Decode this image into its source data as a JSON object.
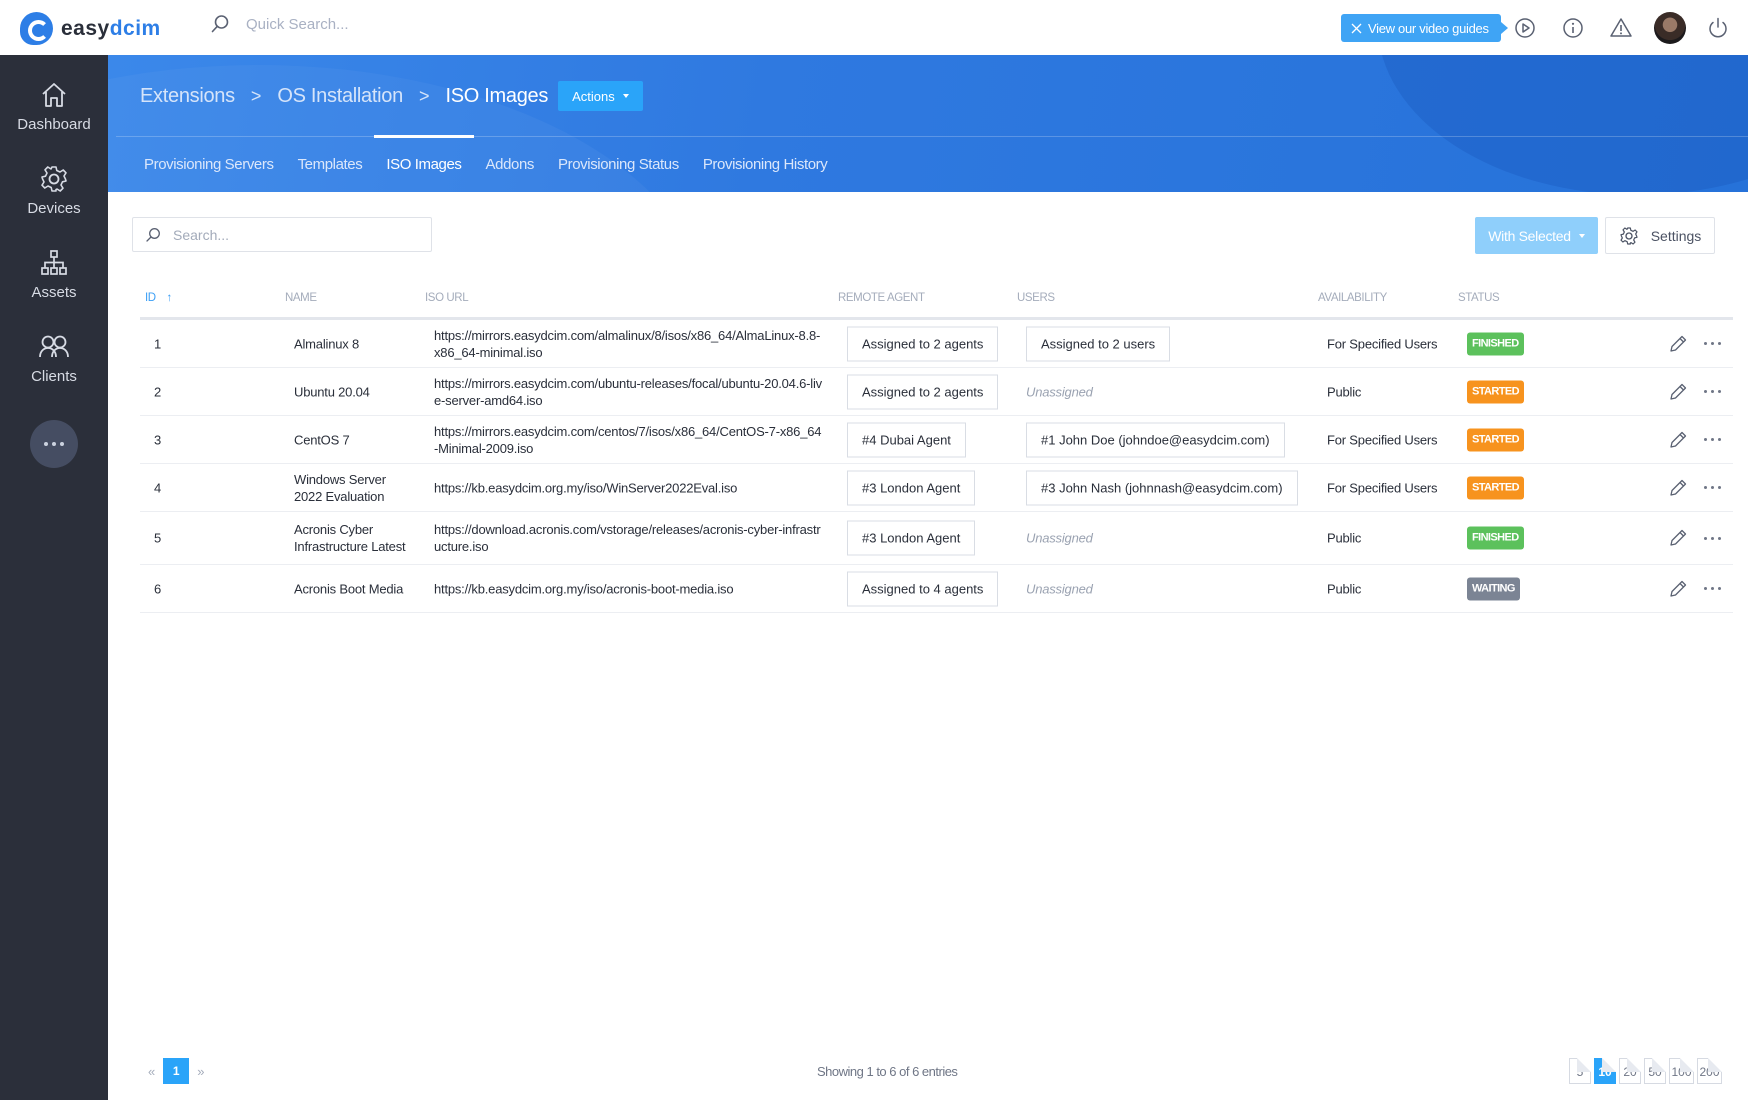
{
  "app": {
    "brand_prefix": "easy",
    "brand_suffix": "dcim"
  },
  "topbar": {
    "quick_search_placeholder": "Quick Search...",
    "video_guides_label": "View our video guides",
    "icons": [
      "play-icon",
      "info-icon",
      "warning-icon",
      "avatar",
      "power-icon"
    ]
  },
  "sidebar": {
    "items": [
      {
        "label": "Dashboard",
        "icon": "home-icon"
      },
      {
        "label": "Devices",
        "icon": "gear-icon"
      },
      {
        "label": "Assets",
        "icon": "sitemap-icon"
      },
      {
        "label": "Clients",
        "icon": "users-icon"
      }
    ],
    "more_icon": "more-icon"
  },
  "header": {
    "breadcrumb": [
      "Extensions",
      "OS Installation",
      "ISO Images"
    ],
    "actions_label": "Actions",
    "tabs": [
      {
        "label": "Provisioning Servers",
        "active": false
      },
      {
        "label": "Templates",
        "active": false
      },
      {
        "label": "ISO Images",
        "active": true
      },
      {
        "label": "Addons",
        "active": false
      },
      {
        "label": "Provisioning Status",
        "active": false
      },
      {
        "label": "Provisioning History",
        "active": false
      }
    ]
  },
  "toolbar": {
    "search_placeholder": "Search...",
    "with_selected_label": "With Selected",
    "settings_label": "Settings"
  },
  "table": {
    "columns": [
      "ID",
      "NAME",
      "ISO URL",
      "REMOTE AGENT",
      "USERS",
      "AVAILABILITY",
      "STATUS"
    ],
    "sort_column": "ID",
    "sort_direction": "asc",
    "rows": [
      {
        "id": "1",
        "name": "Almalinux 8",
        "url": "https://mirrors.easydcim.com/almalinux/8/isos/x86_64/AlmaLinux-8.8-x86_64-minimal.iso",
        "agent": "Assigned to 2 agents",
        "users": "Assigned to 2 users",
        "users_assigned": true,
        "availability": "For Specified Users",
        "status": "FINISHED"
      },
      {
        "id": "2",
        "name": "Ubuntu 20.04",
        "url": "https://mirrors.easydcim.com/ubuntu-releases/focal/ubuntu-20.04.6-live-server-amd64.iso",
        "agent": "Assigned to 2 agents",
        "users": "Unassigned",
        "users_assigned": false,
        "availability": "Public",
        "status": "STARTED"
      },
      {
        "id": "3",
        "name": "CentOS 7",
        "url": "https://mirrors.easydcim.com/centos/7/isos/x86_64/CentOS-7-x86_64-Minimal-2009.iso",
        "agent": "#4 Dubai Agent",
        "users": "#1 John Doe (johndoe@easydcim.com)",
        "users_assigned": true,
        "availability": "For Specified Users",
        "status": "STARTED"
      },
      {
        "id": "4",
        "name": "Windows Server 2022 Evaluation",
        "url": "https://kb.easydcim.org.my/iso/WinServer2022Eval.iso",
        "agent": "#3 London Agent",
        "users": "#3 John Nash (johnnash@easydcim.com)",
        "users_assigned": true,
        "availability": "For Specified Users",
        "status": "STARTED"
      },
      {
        "id": "5",
        "name": "Acronis Cyber Infrastructure Latest",
        "url": "https://download.acronis.com/vstorage/releases/acronis-cyber-infrastructure.iso",
        "agent": "#3 London Agent",
        "users": "Unassigned",
        "users_assigned": false,
        "availability": "Public",
        "status": "FINISHED"
      },
      {
        "id": "6",
        "name": "Acronis Boot Media",
        "url": "https://kb.easydcim.org.my/iso/acronis-boot-media.iso",
        "agent": "Assigned to 4 agents",
        "users": "Unassigned",
        "users_assigned": false,
        "availability": "Public",
        "status": "WAITING"
      }
    ]
  },
  "status_colors": {
    "FINISHED": "#5cc15c",
    "STARTED": "#f7931e",
    "WAITING": "#7b8494"
  },
  "colors": {
    "primary": "#2aa4f9",
    "header_blue": "#2f79e0",
    "sidebar": "#2b2f3a"
  },
  "footer": {
    "current_page": "1",
    "entries_info": "Showing 1 to 6 of 6 entries",
    "per_page_options": [
      "5",
      "10",
      "20",
      "50",
      "100",
      "200"
    ],
    "per_page_selected": "10"
  }
}
